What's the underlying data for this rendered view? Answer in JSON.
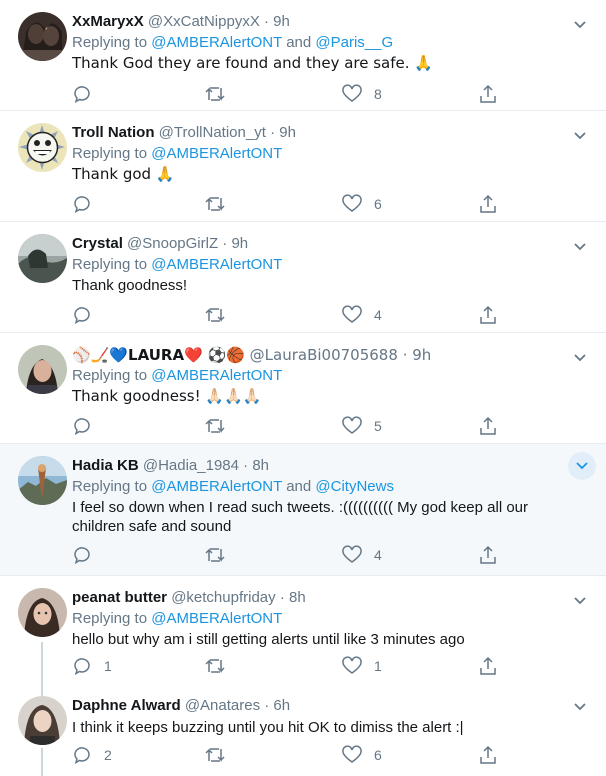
{
  "tweets": [
    {
      "name": "XxMaryxX",
      "handle": "@XxCatNippyxX",
      "dot": "·",
      "time": "9h",
      "reply_prefix": "Replying to ",
      "reply_to": "@AMBERAlertONT",
      "reply_and": " and ",
      "reply_to2": "@Paris__G",
      "text": "Thank God they are found and they are safe. 🙏",
      "comments": "",
      "retweets": "",
      "likes": "8"
    },
    {
      "name": "Troll Nation",
      "handle": "@TrollNation_yt",
      "dot": "·",
      "time": "9h",
      "reply_prefix": "Replying to ",
      "reply_to": "@AMBERAlertONT",
      "text": "Thank god 🙏",
      "comments": "",
      "retweets": "",
      "likes": "6"
    },
    {
      "name": "Crystal",
      "handle": "@SnoopGirlZ",
      "dot": "·",
      "time": "9h",
      "reply_prefix": "Replying to ",
      "reply_to": "@AMBERAlertONT",
      "text": "Thank goodness!",
      "comments": "",
      "retweets": "",
      "likes": "4"
    },
    {
      "name_prefix": "⚾🏒💙",
      "name": "LAURA",
      "name_suffix": "❤️ ⚽🏀",
      "handle": "@LauraBi00705688",
      "dot": "·",
      "time": "9h",
      "reply_prefix": "Replying to ",
      "reply_to": "@AMBERAlertONT",
      "text": "Thank goodness! 🙏🏻🙏🏻🙏🏻",
      "comments": "",
      "retweets": "",
      "likes": "5"
    },
    {
      "name": "Hadia KB",
      "handle": "@Hadia_1984",
      "dot": "·",
      "time": "8h",
      "reply_prefix": "Replying to ",
      "reply_to": "@AMBERAlertONT",
      "reply_and": " and ",
      "reply_to2": "@CityNews",
      "text": "I feel so down when I read such tweets. :(((((((((( My god keep all our children safe and sound",
      "comments": "",
      "retweets": "",
      "likes": "4"
    },
    {
      "name": "peanat butter",
      "handle": "@ketchupfriday",
      "dot": "·",
      "time": "8h",
      "reply_prefix": "Replying to ",
      "reply_to": "@AMBERAlertONT",
      "text": "hello but why am i still getting alerts until like 3 minutes ago",
      "comments": "1",
      "retweets": "",
      "likes": "1"
    },
    {
      "name": "Daphne Alward",
      "handle": "@Anatares",
      "dot": "·",
      "time": "6h",
      "text": "I think it keeps buzzing until you hit OK to dimiss the alert :|",
      "comments": "2",
      "retweets": "",
      "likes": "6"
    }
  ]
}
